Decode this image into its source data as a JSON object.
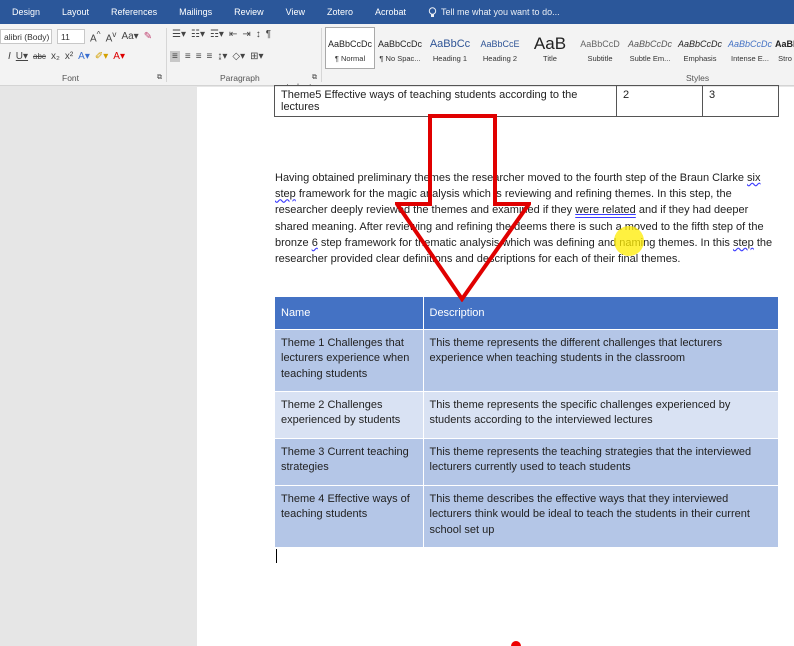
{
  "ribbon": {
    "tabs": [
      "Design",
      "Layout",
      "References",
      "Mailings",
      "Review",
      "View",
      "Zotero",
      "Acrobat"
    ],
    "tell_me": "Tell me what you want to do...",
    "font_name": "alibri (Body)",
    "font_size": "11",
    "group_font": "Font",
    "group_paragraph": "Paragraph",
    "group_styles": "Styles",
    "styles": [
      {
        "preview": "AaBbCcDc",
        "label": "¶ Normal"
      },
      {
        "preview": "AaBbCcDc",
        "label": "¶ No Spac..."
      },
      {
        "preview": "AaBbCc",
        "label": "Heading 1"
      },
      {
        "preview": "AaBbCcE",
        "label": "Heading 2"
      },
      {
        "preview": "AaB",
        "label": "Title"
      },
      {
        "preview": "AaBbCcD",
        "label": "Subtitle"
      },
      {
        "preview": "AaBbCcDc",
        "label": "Subtle Em..."
      },
      {
        "preview": "AaBbCcDc",
        "label": "Emphasis"
      },
      {
        "preview": "AaBbCcDc",
        "label": "Intense E..."
      },
      {
        "preview": "AaBbCcDc",
        "label": "Stro"
      }
    ]
  },
  "doc": {
    "top_table_fragment": "students",
    "top_table_row": {
      "theme": "Theme5 Effective ways of teaching students according to the lectures",
      "col2": "2",
      "col3": "3"
    },
    "paragraph": {
      "p1": "Having obtained preliminary themes the researcher moved to the fourth step of the Braun Clarke ",
      "six": "six",
      "p2": " ",
      "step": "step",
      "p3": " framework for the magic analysis which is reviewing and refining themes. In this step, the researcher deeply reviewed the themes and examined if they ",
      "were_related": "were related",
      "p4": " and if they had deeper shared meaning. After reviewing and refining the deems there is such a moved to the fifth step of the bronze ",
      "six_digit": "6",
      "p5": " step framework for thematic analysis which was defining and naming themes. In this ",
      "step2": "step",
      "p6": " the researcher provided clear definitions and descriptions for each of their final themes."
    },
    "table": {
      "headers": [
        "Name",
        "Description"
      ],
      "rows": [
        {
          "name": "Theme 1 Challenges that lecturers experience when teaching students",
          "desc": "This theme represents the different challenges that lecturers experience when teaching students in the classroom"
        },
        {
          "name": "Theme 2 Challenges experienced by students",
          "desc": "This theme represents the specific challenges experienced by students according to the interviewed lectures"
        },
        {
          "name": "Theme 3 Current teaching strategies",
          "desc": "This theme represents the teaching strategies that the interviewed lecturers currently used to teach students"
        },
        {
          "name": "Theme 4 Effective ways of teaching students",
          "desc": "This theme describes the effective ways that they interviewed lecturers think would be ideal to teach the students in their current school set up"
        }
      ]
    }
  },
  "colors": {
    "ribbon": "#2b579a",
    "table_header": "#4472c4",
    "band_dark": "#b4c6e7",
    "band_light": "#d9e2f3",
    "arrow": "#e00000",
    "cursor_highlight": "#ffec00"
  }
}
